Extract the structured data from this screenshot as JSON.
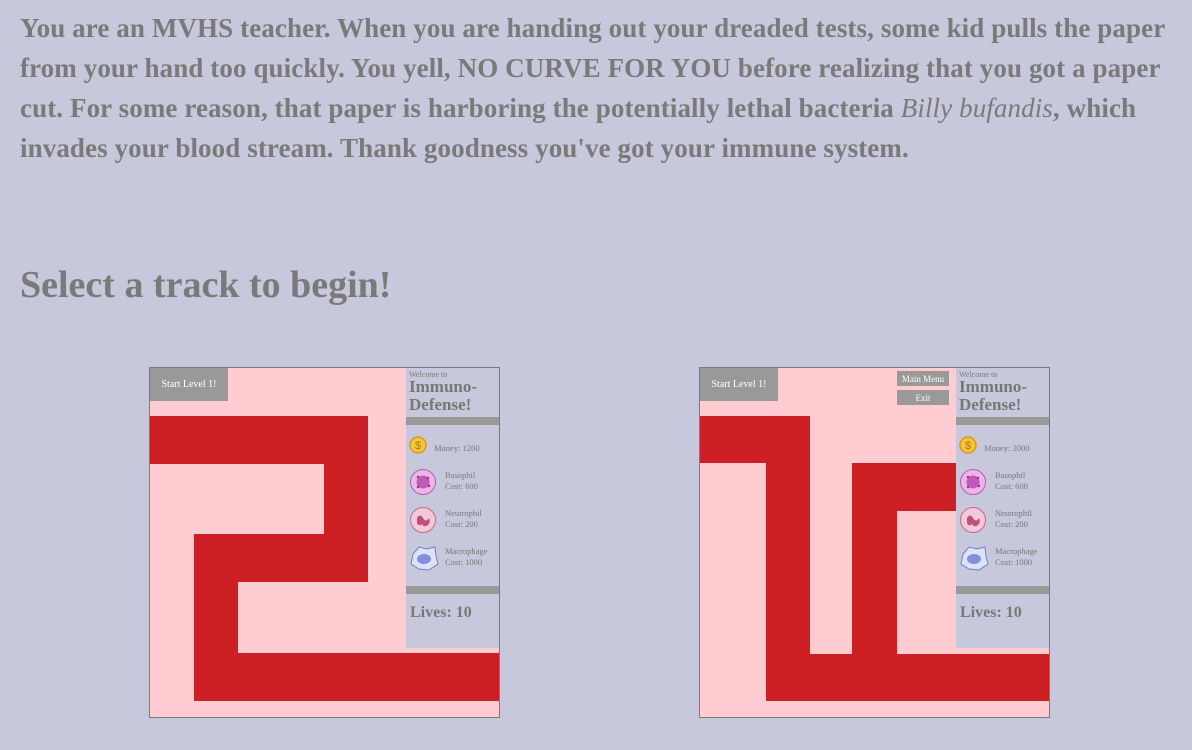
{
  "intro": {
    "text_before": "You are an MVHS teacher. When you are handing out your dreaded tests, some kid pulls the paper from your hand too quickly. You yell, NO CURVE FOR YOU before realizing that you got a paper cut. For some reason, that paper is harboring the potentially lethal bacteria ",
    "species": "Billy bufandis",
    "text_after": ", which invades your blood stream. Thank goodness you've got your immune system."
  },
  "heading": "Select a track to begin!",
  "colors": {
    "background": "#c8c8dc",
    "track_background": "#ffccd2",
    "path": "#cc2025",
    "button": "#999999",
    "text": "#7a7a7a"
  },
  "tracks": [
    {
      "start_label": "Start Level 1!",
      "welcome": "Welcome to",
      "title_line1": "Immuno-",
      "title_line2": "Defense!",
      "money": "Money: 1200",
      "basophil_name": "Basophil",
      "basophil_cost": "Cost: 600",
      "neutrophil_name": "Neutrophil",
      "neutrophil_cost": "Cost: 200",
      "macrophage_name": "Macrophage",
      "macrophage_cost": "Cost: 1000",
      "lives": "Lives: 10"
    },
    {
      "start_label": "Start Level 1!",
      "main_menu_label": "Main Menu",
      "exit_label": "Exit",
      "welcome": "Welcome to",
      "title_line1": "Immuno-",
      "title_line2": "Defense!",
      "money": "Money: 2000",
      "basophil_name": "Basophil",
      "basophil_cost": "Cost: 600",
      "neutrophil_name": "Neutrophil",
      "neutrophil_cost": "Cost: 200",
      "macrophage_name": "Macrophage",
      "macrophage_cost": "Cost: 1000",
      "lives": "Lives: 10"
    }
  ],
  "icons": {
    "money": "coin-icon",
    "basophil": "basophil-cell-icon",
    "neutrophil": "neutrophil-cell-icon",
    "macrophage": "macrophage-cell-icon"
  }
}
